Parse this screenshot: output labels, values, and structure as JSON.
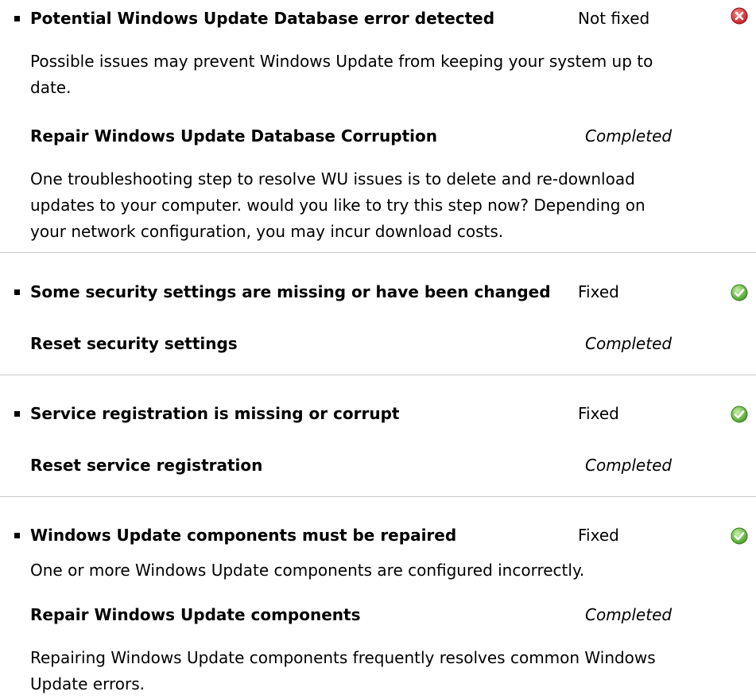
{
  "issues": [
    {
      "title": "Potential Windows Update Database error detected",
      "status": "Not fixed",
      "status_icon": "error-icon",
      "description": "Possible issues may prevent Windows Update from keeping your system up to date.",
      "step": {
        "title": "Repair Windows Update Database Corruption",
        "status": "Completed",
        "description": "One troubleshooting step to resolve WU issues is to delete and re-download updates to your computer. would you like to try this step now? Depending on your network configuration, you may incur download costs."
      }
    },
    {
      "title": "Some security settings are missing or have been changed",
      "status": "Fixed",
      "status_icon": "check-icon",
      "step": {
        "title": "Reset security settings",
        "status": "Completed"
      }
    },
    {
      "title": "Service registration is missing or corrupt",
      "status": "Fixed",
      "status_icon": "check-icon",
      "step": {
        "title": "Reset service registration",
        "status": "Completed"
      }
    },
    {
      "title": "Windows Update components must be repaired",
      "status": "Fixed",
      "status_icon": "check-icon",
      "description": "One or more Windows Update components are configured incorrectly.",
      "step": {
        "title": "Repair Windows Update components",
        "status": "Completed",
        "description": "Repairing Windows Update components frequently resolves common Windows Update errors."
      }
    }
  ],
  "colors": {
    "error": "#d9333f",
    "success": "#5cb82e",
    "divider": "#c8c8c8"
  }
}
